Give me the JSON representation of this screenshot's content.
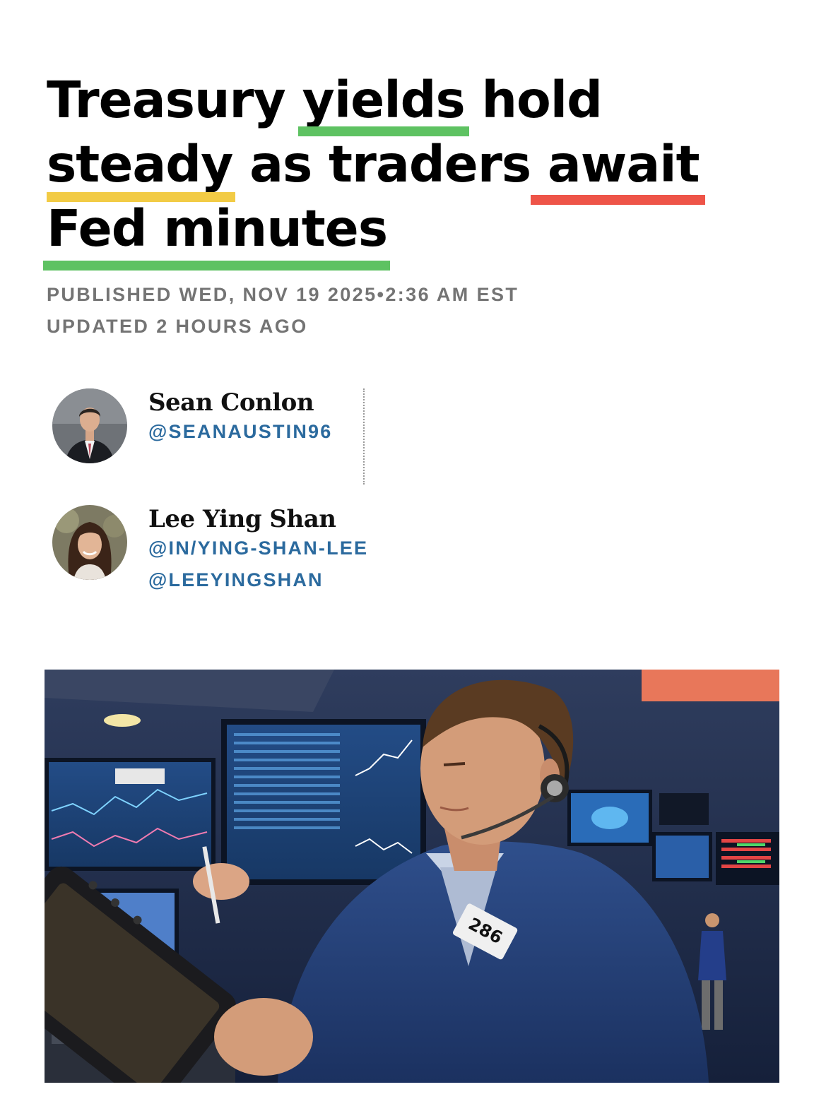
{
  "article": {
    "headline_words": [
      [
        "Treasury",
        "yields",
        "hold"
      ],
      [
        "steady",
        "as",
        "traders",
        "await"
      ],
      [
        "Fed",
        "minutes"
      ]
    ],
    "highlight_colors": {
      "green": "#5ec262",
      "yellow": "#f2cb45",
      "red": "#ee5448"
    },
    "published": "PUBLISHED WED, NOV 19 2025•2:36 AM EST",
    "updated": "UPDATED 2 HOURS AGO"
  },
  "authors": [
    {
      "name": "Sean Conlon",
      "handles": [
        "@SEANAUSTIN96"
      ]
    },
    {
      "name": "Lee Ying Shan",
      "handles": [
        "@IN/YING-SHAN-LEE",
        "@LEEYINGSHAN"
      ]
    }
  ],
  "hero_image": {
    "badge_number": "286"
  }
}
